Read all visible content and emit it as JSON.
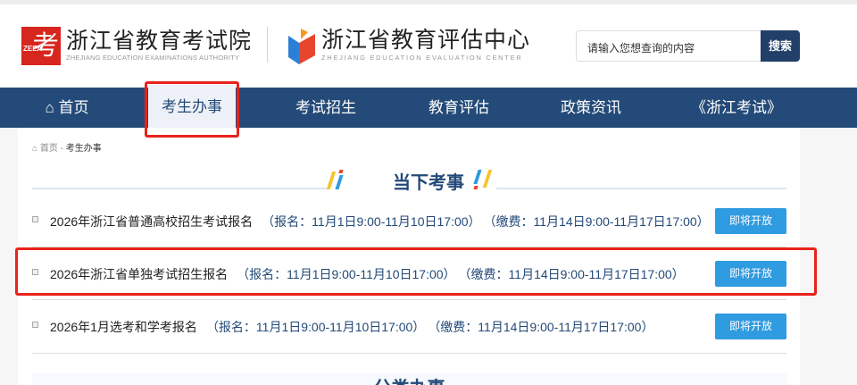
{
  "header": {
    "logo1_title": "浙江省教育考试院",
    "logo1_subtitle": "ZHEJIANG EDUCATION EXAMINATIONS AUTHORITY",
    "logo1_mark": "ZEEA",
    "logo2_title": "浙江省教育评估中心",
    "logo2_subtitle": "ZHEJIANG EDUCATION EVALUATION CENTER",
    "search_placeholder": "请输入您想查询的内容",
    "search_button": "搜索"
  },
  "nav": [
    {
      "label": "首页"
    },
    {
      "label": "考生办事"
    },
    {
      "label": "考试招生"
    },
    {
      "label": "教育评估"
    },
    {
      "label": "政策资讯"
    },
    {
      "label": "《浙江考试》"
    }
  ],
  "breadcrumb": {
    "home": "首页",
    "sep": "-",
    "current": "考生办事"
  },
  "section_title": "当下考事",
  "items": [
    {
      "title": "2026年浙江省普通高校招生考试报名",
      "reg": "（报名：11月1日9:00-11月10日17:00）",
      "pay": "（缴费：11月14日9:00-11月17日17:00）",
      "button": "即将开放"
    },
    {
      "title": "2026年浙江省单独考试招生报名",
      "reg": "（报名：11月1日9:00-11月10日17:00）",
      "pay": "（缴费：11月14日9:00-11月17日17:00）",
      "button": "即将开放"
    },
    {
      "title": "2026年1月选考和学考报名",
      "reg": "（报名：11月1日9:00-11月10日17:00）",
      "pay": "（缴费：11月14日9:00-11月17日17:00）",
      "button": "即将开放"
    }
  ],
  "section2_title": "分类办事"
}
